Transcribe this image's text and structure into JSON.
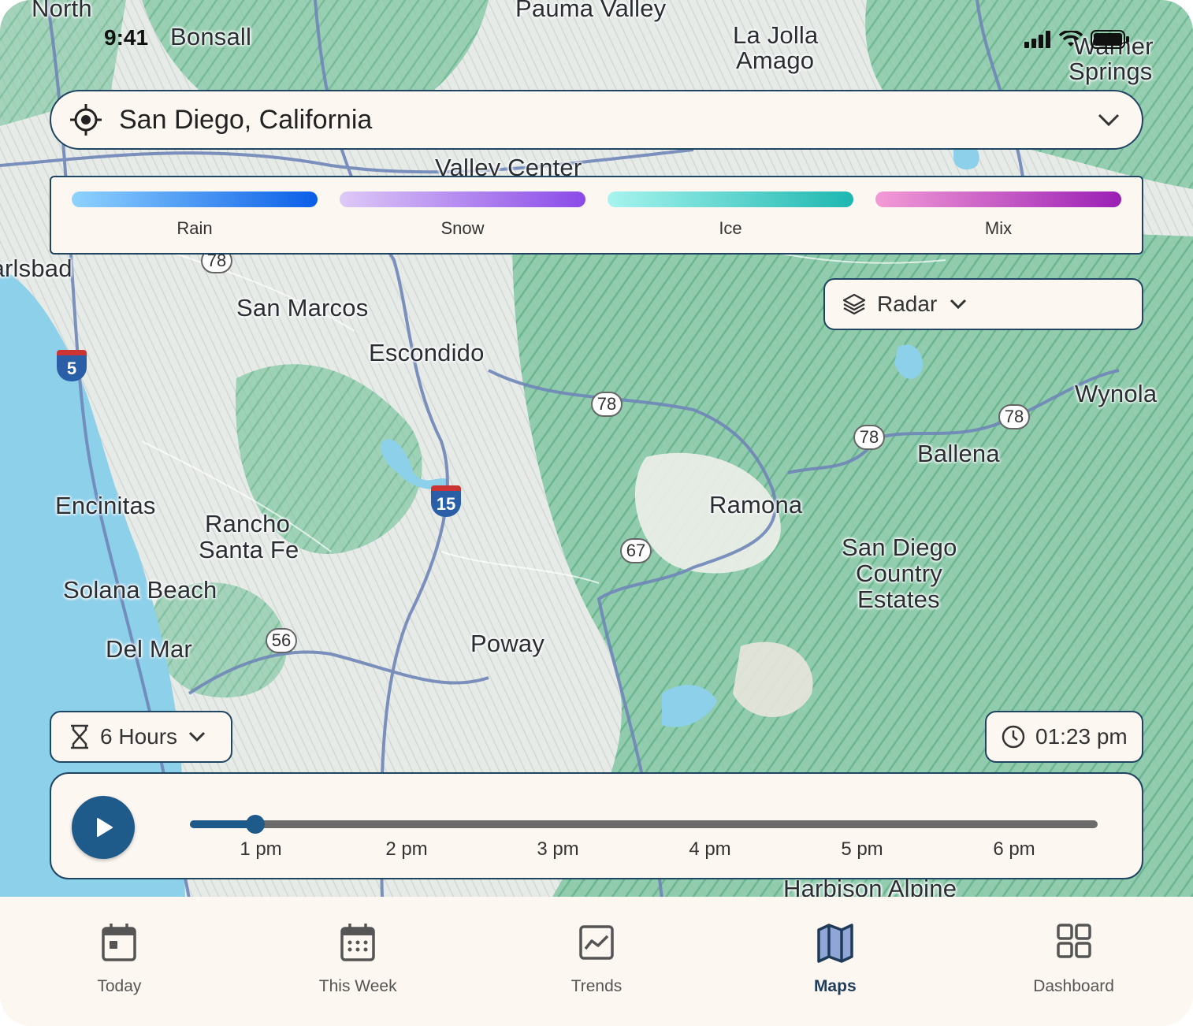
{
  "status_bar": {
    "time": "9:41"
  },
  "map": {
    "places": [
      {
        "name": "North"
      },
      {
        "name": "Bonsall"
      },
      {
        "name": "Pauma Valley"
      },
      {
        "name": "La Jolla"
      },
      {
        "name": "Amago"
      },
      {
        "name": "Warner"
      },
      {
        "name": "Springs"
      },
      {
        "name": "Valley Center"
      },
      {
        "name": "Carlsbad"
      },
      {
        "name": "San Marcos"
      },
      {
        "name": "Escondido"
      },
      {
        "name": "Wynola"
      },
      {
        "name": "Ballena"
      },
      {
        "name": "Encinitas"
      },
      {
        "name": "Ramona"
      },
      {
        "name": "Rancho"
      },
      {
        "name": "Santa Fe"
      },
      {
        "name": "San Diego"
      },
      {
        "name": "Country"
      },
      {
        "name": "Estates"
      },
      {
        "name": "Solana Beach"
      },
      {
        "name": "Del Mar"
      },
      {
        "name": "Poway"
      },
      {
        "name": "Harbison Alpine"
      }
    ],
    "route_shields": [
      "78",
      "78",
      "78",
      "78",
      "67",
      "56"
    ],
    "interstates": [
      "5",
      "15"
    ]
  },
  "location_bar": {
    "value": "San Diego, California"
  },
  "legend": {
    "items": [
      {
        "label": "Rain",
        "from": "#8fd3ff",
        "to": "#0a5de8"
      },
      {
        "label": "Snow",
        "from": "#ddc9f7",
        "to": "#8a4ae8"
      },
      {
        "label": "Ice",
        "from": "#a7f4ee",
        "to": "#1db7b0"
      },
      {
        "label": "Mix",
        "from": "#f39bd6",
        "to": "#9a1fb5"
      }
    ]
  },
  "layer_select": {
    "value": "Radar"
  },
  "duration_select": {
    "value": "6 Hours"
  },
  "time_display": {
    "value": "01:23 pm"
  },
  "timeline": {
    "progress": 0.072,
    "ticks": [
      "1 pm",
      "2 pm",
      "3 pm",
      "4 pm",
      "5 pm",
      "6 pm"
    ]
  },
  "bottom_nav": {
    "items": [
      {
        "label": "Today",
        "icon": "calendar-day-icon"
      },
      {
        "label": "This Week",
        "icon": "calendar-week-icon"
      },
      {
        "label": "Trends",
        "icon": "trend-chart-icon"
      },
      {
        "label": "Maps",
        "icon": "map-icon",
        "active": true
      },
      {
        "label": "Dashboard",
        "icon": "dashboard-grid-icon"
      }
    ]
  },
  "colors": {
    "accent": "#1e5a8a",
    "panel_bg": "#fdf7f2",
    "panel_border": "#1f4561",
    "ocean": "#8dd0ea",
    "terrain_green": "#7fc6a0"
  }
}
